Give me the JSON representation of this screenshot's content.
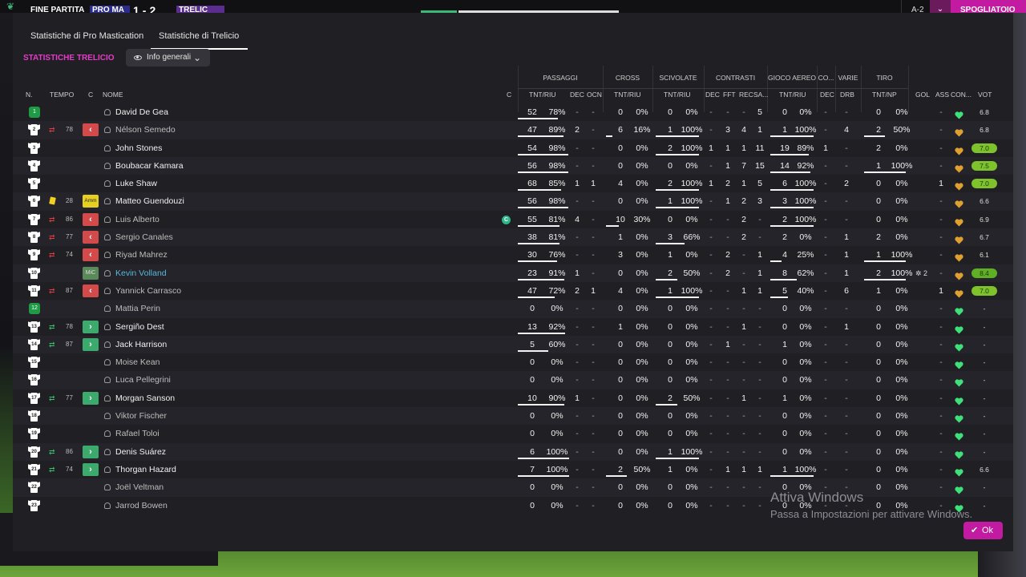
{
  "topbar": {
    "end_match_label": "FINE PARTITA",
    "home_team": "PRO MA",
    "score": "1-2",
    "away_team": "TRELIC",
    "zoom_label": "A-2",
    "dressing_room_label": "SPOGLIATOIO"
  },
  "tabs": [
    {
      "label": "Statistiche di Pro Mastication",
      "active": false
    },
    {
      "label": "Statistiche di Trelicio",
      "active": true
    }
  ],
  "section_title": "STATISTICHE TRELICIO",
  "view_select": {
    "selected": "Info generali"
  },
  "group_headers": {
    "passaggi": "PASSAGGI",
    "cross": "CROSS",
    "scivolate": "SCIVOLATE",
    "contrasti": "CONTRASTI",
    "gioco_aereo": "GIOCO AEREO",
    "co": "CO...",
    "varie": "VARIE",
    "tiro": "TIRO"
  },
  "columns": {
    "n": "N.",
    "tempo": "TEMPO",
    "c": "C",
    "nome": "NOME",
    "c2": "C",
    "pass_tnt": "TNT/RIU",
    "pass_dec": "DEC",
    "pass_ocn": "OCN",
    "cross_tnt": "TNT/RIU",
    "sciv_tnt": "TNT/RIU",
    "con_dec": "DEC",
    "con_fft": "FFT",
    "con_rec": "REC",
    "con_sa": "SA...",
    "aereo_tnt": "TNT/RIU",
    "co_dec": "DEC",
    "drb": "DRB",
    "tiro_tnt": "TNT/NP",
    "gol": "GOL",
    "ass": "ASS",
    "con": "CON...",
    "vot": "VOT"
  },
  "players": [
    {
      "num": "1",
      "gk": true,
      "tempo_icon": "",
      "minute": "",
      "pos": "",
      "name": "David De Gea",
      "style": "",
      "pass_a": "52",
      "pass_b": "78%",
      "pass_bar": 0.78,
      "dec": "-",
      "ocn": "-",
      "cross_a": "0",
      "cross_b": "0%",
      "cross_bar": 0,
      "sciv_a": "0",
      "sciv_b": "0%",
      "sciv_bar": 0,
      "c_dec": "-",
      "c_fft": "-",
      "c_rec": "-",
      "c_sa": "5",
      "aer_a": "0",
      "aer_b": "0%",
      "aer_bar": 0,
      "co_dec": "-",
      "drb": "-",
      "tiro_a": "0",
      "tiro_b": "0%",
      "tiro_bar": 0,
      "gol": "",
      "ass": "-",
      "heart": "green",
      "vot": "6.8",
      "vot_style": ""
    },
    {
      "num": "2",
      "gk": false,
      "tempo_icon": "out",
      "minute": "78",
      "pos": "out",
      "name": "Nélson Semedo",
      "style": "sub",
      "pass_a": "47",
      "pass_b": "89%",
      "pass_bar": 0.89,
      "dec": "2",
      "ocn": "-",
      "cross_a": "6",
      "cross_b": "16%",
      "cross_bar": 0.16,
      "sciv_a": "1",
      "sciv_b": "100%",
      "sciv_bar": 1,
      "c_dec": "-",
      "c_fft": "3",
      "c_rec": "4",
      "c_sa": "1",
      "aer_a": "1",
      "aer_b": "100%",
      "aer_bar": 1,
      "co_dec": "-",
      "drb": "4",
      "tiro_a": "2",
      "tiro_b": "50%",
      "tiro_bar": 0.5,
      "gol": "",
      "ass": "-",
      "heart": "gold",
      "vot": "6.8",
      "vot_style": ""
    },
    {
      "num": "3",
      "gk": false,
      "tempo_icon": "",
      "minute": "",
      "pos": "",
      "name": "John Stones",
      "style": "",
      "pass_a": "54",
      "pass_b": "98%",
      "pass_bar": 0.98,
      "dec": "-",
      "ocn": "-",
      "cross_a": "0",
      "cross_b": "0%",
      "cross_bar": 0,
      "sciv_a": "2",
      "sciv_b": "100%",
      "sciv_bar": 1,
      "c_dec": "1",
      "c_fft": "1",
      "c_rec": "1",
      "c_sa": "11",
      "aer_a": "19",
      "aer_b": "89%",
      "aer_bar": 0.89,
      "co_dec": "1",
      "drb": "-",
      "tiro_a": "2",
      "tiro_b": "0%",
      "tiro_bar": 0,
      "gol": "",
      "ass": "-",
      "heart": "gold",
      "vot": "7.0",
      "vot_style": "hi"
    },
    {
      "num": "4",
      "gk": false,
      "tempo_icon": "",
      "minute": "",
      "pos": "",
      "name": "Boubacar Kamara",
      "style": "",
      "pass_a": "56",
      "pass_b": "98%",
      "pass_bar": 0.98,
      "dec": "-",
      "ocn": "-",
      "cross_a": "0",
      "cross_b": "0%",
      "cross_bar": 0,
      "sciv_a": "0",
      "sciv_b": "0%",
      "sciv_bar": 0,
      "c_dec": "-",
      "c_fft": "1",
      "c_rec": "7",
      "c_sa": "15",
      "aer_a": "14",
      "aer_b": "92%",
      "aer_bar": 0.92,
      "co_dec": "-",
      "drb": "-",
      "tiro_a": "1",
      "tiro_b": "100%",
      "tiro_bar": 1,
      "gol": "",
      "ass": "-",
      "heart": "gold",
      "vot": "7.5",
      "vot_style": "hi"
    },
    {
      "num": "5",
      "gk": false,
      "tempo_icon": "",
      "minute": "",
      "pos": "",
      "name": "Luke Shaw",
      "style": "",
      "pass_a": "68",
      "pass_b": "85%",
      "pass_bar": 0.85,
      "dec": "1",
      "ocn": "1",
      "cross_a": "4",
      "cross_b": "0%",
      "cross_bar": 0,
      "sciv_a": "2",
      "sciv_b": "100%",
      "sciv_bar": 1,
      "c_dec": "1",
      "c_fft": "2",
      "c_rec": "1",
      "c_sa": "5",
      "aer_a": "6",
      "aer_b": "100%",
      "aer_bar": 1,
      "co_dec": "-",
      "drb": "2",
      "tiro_a": "0",
      "tiro_b": "0%",
      "tiro_bar": 0,
      "gol": "",
      "ass": "1",
      "heart": "gold",
      "vot": "7.0",
      "vot_style": "hi"
    },
    {
      "num": "6",
      "gk": false,
      "tempo_icon": "yellow",
      "minute": "28",
      "pos": "amm",
      "name": "Matteo Guendouzi",
      "style": "",
      "pass_a": "56",
      "pass_b": "98%",
      "pass_bar": 0.98,
      "dec": "-",
      "ocn": "-",
      "cross_a": "0",
      "cross_b": "0%",
      "cross_bar": 0,
      "sciv_a": "1",
      "sciv_b": "100%",
      "sciv_bar": 1,
      "c_dec": "-",
      "c_fft": "1",
      "c_rec": "2",
      "c_sa": "3",
      "aer_a": "3",
      "aer_b": "100%",
      "aer_bar": 1,
      "co_dec": "-",
      "drb": "-",
      "tiro_a": "0",
      "tiro_b": "0%",
      "tiro_bar": 0,
      "gol": "",
      "ass": "-",
      "heart": "gold",
      "vot": "6.6",
      "vot_style": ""
    },
    {
      "num": "7",
      "gk": false,
      "tempo_icon": "out",
      "minute": "86",
      "pos": "out",
      "name": "Luis Alberto",
      "style": "sub",
      "captain": true,
      "pass_a": "55",
      "pass_b": "81%",
      "pass_bar": 0.81,
      "dec": "4",
      "ocn": "-",
      "cross_a": "10",
      "cross_b": "30%",
      "cross_bar": 0.3,
      "sciv_a": "0",
      "sciv_b": "0%",
      "sciv_bar": 0,
      "c_dec": "-",
      "c_fft": "-",
      "c_rec": "2",
      "c_sa": "-",
      "aer_a": "2",
      "aer_b": "100%",
      "aer_bar": 1,
      "co_dec": "-",
      "drb": "-",
      "tiro_a": "0",
      "tiro_b": "0%",
      "tiro_bar": 0,
      "gol": "",
      "ass": "-",
      "heart": "gold",
      "vot": "6.9",
      "vot_style": ""
    },
    {
      "num": "8",
      "gk": false,
      "tempo_icon": "out",
      "minute": "77",
      "pos": "out",
      "name": "Sergio Canales",
      "style": "sub",
      "pass_a": "38",
      "pass_b": "81%",
      "pass_bar": 0.81,
      "dec": "-",
      "ocn": "-",
      "cross_a": "1",
      "cross_b": "0%",
      "cross_bar": 0,
      "sciv_a": "3",
      "sciv_b": "66%",
      "sciv_bar": 0.66,
      "c_dec": "-",
      "c_fft": "-",
      "c_rec": "2",
      "c_sa": "-",
      "aer_a": "2",
      "aer_b": "0%",
      "aer_bar": 0,
      "co_dec": "-",
      "drb": "1",
      "tiro_a": "2",
      "tiro_b": "0%",
      "tiro_bar": 0,
      "gol": "",
      "ass": "-",
      "heart": "gold",
      "vot": "6.7",
      "vot_style": ""
    },
    {
      "num": "9",
      "gk": false,
      "tempo_icon": "out",
      "minute": "74",
      "pos": "out",
      "name": "Riyad Mahrez",
      "style": "sub",
      "pass_a": "30",
      "pass_b": "76%",
      "pass_bar": 0.76,
      "dec": "-",
      "ocn": "-",
      "cross_a": "3",
      "cross_b": "0%",
      "cross_bar": 0,
      "sciv_a": "1",
      "sciv_b": "0%",
      "sciv_bar": 0,
      "c_dec": "-",
      "c_fft": "2",
      "c_rec": "-",
      "c_sa": "1",
      "aer_a": "4",
      "aer_b": "25%",
      "aer_bar": 0.25,
      "co_dec": "-",
      "drb": "1",
      "tiro_a": "1",
      "tiro_b": "100%",
      "tiro_bar": 1,
      "gol": "",
      "ass": "-",
      "heart": "gold",
      "vot": "6.1",
      "vot_style": ""
    },
    {
      "num": "10",
      "gk": false,
      "tempo_icon": "",
      "minute": "",
      "pos": "mic",
      "name": "Kevin Volland",
      "style": "link",
      "pass_a": "23",
      "pass_b": "91%",
      "pass_bar": 0.91,
      "dec": "1",
      "ocn": "-",
      "cross_a": "0",
      "cross_b": "0%",
      "cross_bar": 0,
      "sciv_a": "2",
      "sciv_b": "50%",
      "sciv_bar": 0.5,
      "c_dec": "-",
      "c_fft": "2",
      "c_rec": "-",
      "c_sa": "1",
      "aer_a": "8",
      "aer_b": "62%",
      "aer_bar": 0.62,
      "co_dec": "-",
      "drb": "1",
      "tiro_a": "2",
      "tiro_b": "100%",
      "tiro_bar": 1,
      "gol": "2",
      "ass": "-",
      "heart": "gold",
      "vot": "8.4",
      "vot_style": "vhi"
    },
    {
      "num": "11",
      "gk": false,
      "tempo_icon": "out",
      "minute": "87",
      "pos": "out",
      "name": "Yannick Carrasco",
      "style": "sub",
      "pass_a": "47",
      "pass_b": "72%",
      "pass_bar": 0.72,
      "dec": "2",
      "ocn": "1",
      "cross_a": "4",
      "cross_b": "0%",
      "cross_bar": 0,
      "sciv_a": "1",
      "sciv_b": "100%",
      "sciv_bar": 1,
      "c_dec": "-",
      "c_fft": "-",
      "c_rec": "1",
      "c_sa": "1",
      "aer_a": "5",
      "aer_b": "40%",
      "aer_bar": 0.4,
      "co_dec": "-",
      "drb": "6",
      "tiro_a": "1",
      "tiro_b": "0%",
      "tiro_bar": 0,
      "gol": "",
      "ass": "1",
      "heart": "gold",
      "vot": "7.0",
      "vot_style": "hi"
    },
    {
      "num": "12",
      "gk": true,
      "tempo_icon": "",
      "minute": "",
      "pos": "",
      "name": "Mattia Perin",
      "style": "sub",
      "pass_a": "0",
      "pass_b": "0%",
      "pass_bar": 0,
      "dec": "-",
      "ocn": "-",
      "cross_a": "0",
      "cross_b": "0%",
      "cross_bar": 0,
      "sciv_a": "0",
      "sciv_b": "0%",
      "sciv_bar": 0,
      "c_dec": "-",
      "c_fft": "-",
      "c_rec": "-",
      "c_sa": "-",
      "aer_a": "0",
      "aer_b": "0%",
      "aer_bar": 0,
      "co_dec": "-",
      "drb": "-",
      "tiro_a": "0",
      "tiro_b": "0%",
      "tiro_bar": 0,
      "gol": "",
      "ass": "-",
      "heart": "green",
      "vot": "-",
      "vot_style": ""
    },
    {
      "num": "13",
      "gk": false,
      "tempo_icon": "in",
      "minute": "78",
      "pos": "in",
      "name": "Sergiño Dest",
      "style": "",
      "pass_a": "13",
      "pass_b": "92%",
      "pass_bar": 0.92,
      "dec": "-",
      "ocn": "-",
      "cross_a": "1",
      "cross_b": "0%",
      "cross_bar": 0,
      "sciv_a": "0",
      "sciv_b": "0%",
      "sciv_bar": 0,
      "c_dec": "-",
      "c_fft": "-",
      "c_rec": "1",
      "c_sa": "-",
      "aer_a": "0",
      "aer_b": "0%",
      "aer_bar": 0,
      "co_dec": "-",
      "drb": "1",
      "tiro_a": "0",
      "tiro_b": "0%",
      "tiro_bar": 0,
      "gol": "",
      "ass": "-",
      "heart": "green",
      "vot": "-",
      "vot_style": ""
    },
    {
      "num": "14",
      "gk": false,
      "tempo_icon": "in",
      "minute": "87",
      "pos": "in",
      "name": "Jack Harrison",
      "style": "",
      "pass_a": "5",
      "pass_b": "60%",
      "pass_bar": 0.6,
      "dec": "-",
      "ocn": "-",
      "cross_a": "0",
      "cross_b": "0%",
      "cross_bar": 0,
      "sciv_a": "0",
      "sciv_b": "0%",
      "sciv_bar": 0,
      "c_dec": "-",
      "c_fft": "1",
      "c_rec": "-",
      "c_sa": "-",
      "aer_a": "1",
      "aer_b": "0%",
      "aer_bar": 0,
      "co_dec": "-",
      "drb": "-",
      "tiro_a": "0",
      "tiro_b": "0%",
      "tiro_bar": 0,
      "gol": "",
      "ass": "-",
      "heart": "green",
      "vot": "-",
      "vot_style": ""
    },
    {
      "num": "15",
      "gk": false,
      "tempo_icon": "",
      "minute": "",
      "pos": "",
      "name": "Moise Kean",
      "style": "sub",
      "pass_a": "0",
      "pass_b": "0%",
      "pass_bar": 0,
      "dec": "-",
      "ocn": "-",
      "cross_a": "0",
      "cross_b": "0%",
      "cross_bar": 0,
      "sciv_a": "0",
      "sciv_b": "0%",
      "sciv_bar": 0,
      "c_dec": "-",
      "c_fft": "-",
      "c_rec": "-",
      "c_sa": "-",
      "aer_a": "0",
      "aer_b": "0%",
      "aer_bar": 0,
      "co_dec": "-",
      "drb": "-",
      "tiro_a": "0",
      "tiro_b": "0%",
      "tiro_bar": 0,
      "gol": "",
      "ass": "-",
      "heart": "green",
      "vot": "-",
      "vot_style": ""
    },
    {
      "num": "16",
      "gk": false,
      "tempo_icon": "",
      "minute": "",
      "pos": "",
      "name": "Luca Pellegrini",
      "style": "sub",
      "pass_a": "0",
      "pass_b": "0%",
      "pass_bar": 0,
      "dec": "-",
      "ocn": "-",
      "cross_a": "0",
      "cross_b": "0%",
      "cross_bar": 0,
      "sciv_a": "0",
      "sciv_b": "0%",
      "sciv_bar": 0,
      "c_dec": "-",
      "c_fft": "-",
      "c_rec": "-",
      "c_sa": "-",
      "aer_a": "0",
      "aer_b": "0%",
      "aer_bar": 0,
      "co_dec": "-",
      "drb": "-",
      "tiro_a": "0",
      "tiro_b": "0%",
      "tiro_bar": 0,
      "gol": "",
      "ass": "-",
      "heart": "green",
      "vot": "-",
      "vot_style": ""
    },
    {
      "num": "17",
      "gk": false,
      "tempo_icon": "in",
      "minute": "77",
      "pos": "in",
      "name": "Morgan Sanson",
      "style": "",
      "pass_a": "10",
      "pass_b": "90%",
      "pass_bar": 0.9,
      "dec": "1",
      "ocn": "-",
      "cross_a": "0",
      "cross_b": "0%",
      "cross_bar": 0,
      "sciv_a": "2",
      "sciv_b": "50%",
      "sciv_bar": 0.5,
      "c_dec": "-",
      "c_fft": "-",
      "c_rec": "1",
      "c_sa": "-",
      "aer_a": "1",
      "aer_b": "0%",
      "aer_bar": 0,
      "co_dec": "-",
      "drb": "-",
      "tiro_a": "0",
      "tiro_b": "0%",
      "tiro_bar": 0,
      "gol": "",
      "ass": "-",
      "heart": "green",
      "vot": "-",
      "vot_style": ""
    },
    {
      "num": "18",
      "gk": false,
      "tempo_icon": "",
      "minute": "",
      "pos": "",
      "name": "Viktor Fischer",
      "style": "sub",
      "pass_a": "0",
      "pass_b": "0%",
      "pass_bar": 0,
      "dec": "-",
      "ocn": "-",
      "cross_a": "0",
      "cross_b": "0%",
      "cross_bar": 0,
      "sciv_a": "0",
      "sciv_b": "0%",
      "sciv_bar": 0,
      "c_dec": "-",
      "c_fft": "-",
      "c_rec": "-",
      "c_sa": "-",
      "aer_a": "0",
      "aer_b": "0%",
      "aer_bar": 0,
      "co_dec": "-",
      "drb": "-",
      "tiro_a": "0",
      "tiro_b": "0%",
      "tiro_bar": 0,
      "gol": "",
      "ass": "-",
      "heart": "green",
      "vot": "-",
      "vot_style": ""
    },
    {
      "num": "19",
      "gk": false,
      "tempo_icon": "",
      "minute": "",
      "pos": "",
      "name": "Rafael Toloi",
      "style": "sub",
      "pass_a": "0",
      "pass_b": "0%",
      "pass_bar": 0,
      "dec": "-",
      "ocn": "-",
      "cross_a": "0",
      "cross_b": "0%",
      "cross_bar": 0,
      "sciv_a": "0",
      "sciv_b": "0%",
      "sciv_bar": 0,
      "c_dec": "-",
      "c_fft": "-",
      "c_rec": "-",
      "c_sa": "-",
      "aer_a": "0",
      "aer_b": "0%",
      "aer_bar": 0,
      "co_dec": "-",
      "drb": "-",
      "tiro_a": "0",
      "tiro_b": "0%",
      "tiro_bar": 0,
      "gol": "",
      "ass": "-",
      "heart": "green",
      "vot": "-",
      "vot_style": ""
    },
    {
      "num": "20",
      "gk": false,
      "tempo_icon": "in",
      "minute": "86",
      "pos": "in",
      "name": "Denis Suárez",
      "style": "",
      "pass_a": "6",
      "pass_b": "100%",
      "pass_bar": 1,
      "dec": "-",
      "ocn": "-",
      "cross_a": "0",
      "cross_b": "0%",
      "cross_bar": 0,
      "sciv_a": "1",
      "sciv_b": "100%",
      "sciv_bar": 1,
      "c_dec": "-",
      "c_fft": "-",
      "c_rec": "-",
      "c_sa": "-",
      "aer_a": "0",
      "aer_b": "0%",
      "aer_bar": 0,
      "co_dec": "-",
      "drb": "-",
      "tiro_a": "0",
      "tiro_b": "0%",
      "tiro_bar": 0,
      "gol": "",
      "ass": "-",
      "heart": "green",
      "vot": "-",
      "vot_style": ""
    },
    {
      "num": "21",
      "gk": false,
      "tempo_icon": "in",
      "minute": "74",
      "pos": "in",
      "name": "Thorgan Hazard",
      "style": "",
      "pass_a": "7",
      "pass_b": "100%",
      "pass_bar": 1,
      "dec": "-",
      "ocn": "-",
      "cross_a": "2",
      "cross_b": "50%",
      "cross_bar": 0.5,
      "sciv_a": "1",
      "sciv_b": "0%",
      "sciv_bar": 0,
      "c_dec": "-",
      "c_fft": "1",
      "c_rec": "1",
      "c_sa": "1",
      "aer_a": "1",
      "aer_b": "100%",
      "aer_bar": 1,
      "co_dec": "-",
      "drb": "-",
      "tiro_a": "0",
      "tiro_b": "0%",
      "tiro_bar": 0,
      "gol": "",
      "ass": "-",
      "heart": "green",
      "vot": "6.6",
      "vot_style": ""
    },
    {
      "num": "22",
      "gk": false,
      "tempo_icon": "",
      "minute": "",
      "pos": "",
      "name": "Joël Veltman",
      "style": "sub",
      "pass_a": "0",
      "pass_b": "0%",
      "pass_bar": 0,
      "dec": "-",
      "ocn": "-",
      "cross_a": "0",
      "cross_b": "0%",
      "cross_bar": 0,
      "sciv_a": "0",
      "sciv_b": "0%",
      "sciv_bar": 0,
      "c_dec": "-",
      "c_fft": "-",
      "c_rec": "-",
      "c_sa": "-",
      "aer_a": "0",
      "aer_b": "0%",
      "aer_bar": 0,
      "co_dec": "-",
      "drb": "-",
      "tiro_a": "0",
      "tiro_b": "0%",
      "tiro_bar": 0,
      "gol": "",
      "ass": "-",
      "heart": "green",
      "vot": "-",
      "vot_style": ""
    },
    {
      "num": "23",
      "gk": false,
      "tempo_icon": "",
      "minute": "",
      "pos": "",
      "name": "Jarrod Bowen",
      "style": "sub",
      "pass_a": "0",
      "pass_b": "0%",
      "pass_bar": 0,
      "dec": "-",
      "ocn": "-",
      "cross_a": "0",
      "cross_b": "0%",
      "cross_bar": 0,
      "sciv_a": "0",
      "sciv_b": "0%",
      "sciv_bar": 0,
      "c_dec": "-",
      "c_fft": "-",
      "c_rec": "-",
      "c_sa": "-",
      "aer_a": "0",
      "aer_b": "0%",
      "aer_bar": 0,
      "co_dec": "-",
      "drb": "-",
      "tiro_a": "0",
      "tiro_b": "0%",
      "tiro_bar": 0,
      "gol": "",
      "ass": "-",
      "heart": "green",
      "vot": "-",
      "vot_style": ""
    }
  ],
  "pos_labels": {
    "amm": "Amm",
    "mic": "MiC",
    "out": "‹",
    "in": "›"
  },
  "captain_label": "C",
  "colors": {
    "accent": "#c21aa0",
    "title": "#e63cc8",
    "heart_green": "#3ee07a",
    "heart_gold": "#e0a030",
    "rating_green": "#7ec22c"
  },
  "watermark": {
    "line1": "Attiva Windows",
    "line2": "Passa a Impostazioni per attivare Windows."
  },
  "ok_label": "Ok"
}
